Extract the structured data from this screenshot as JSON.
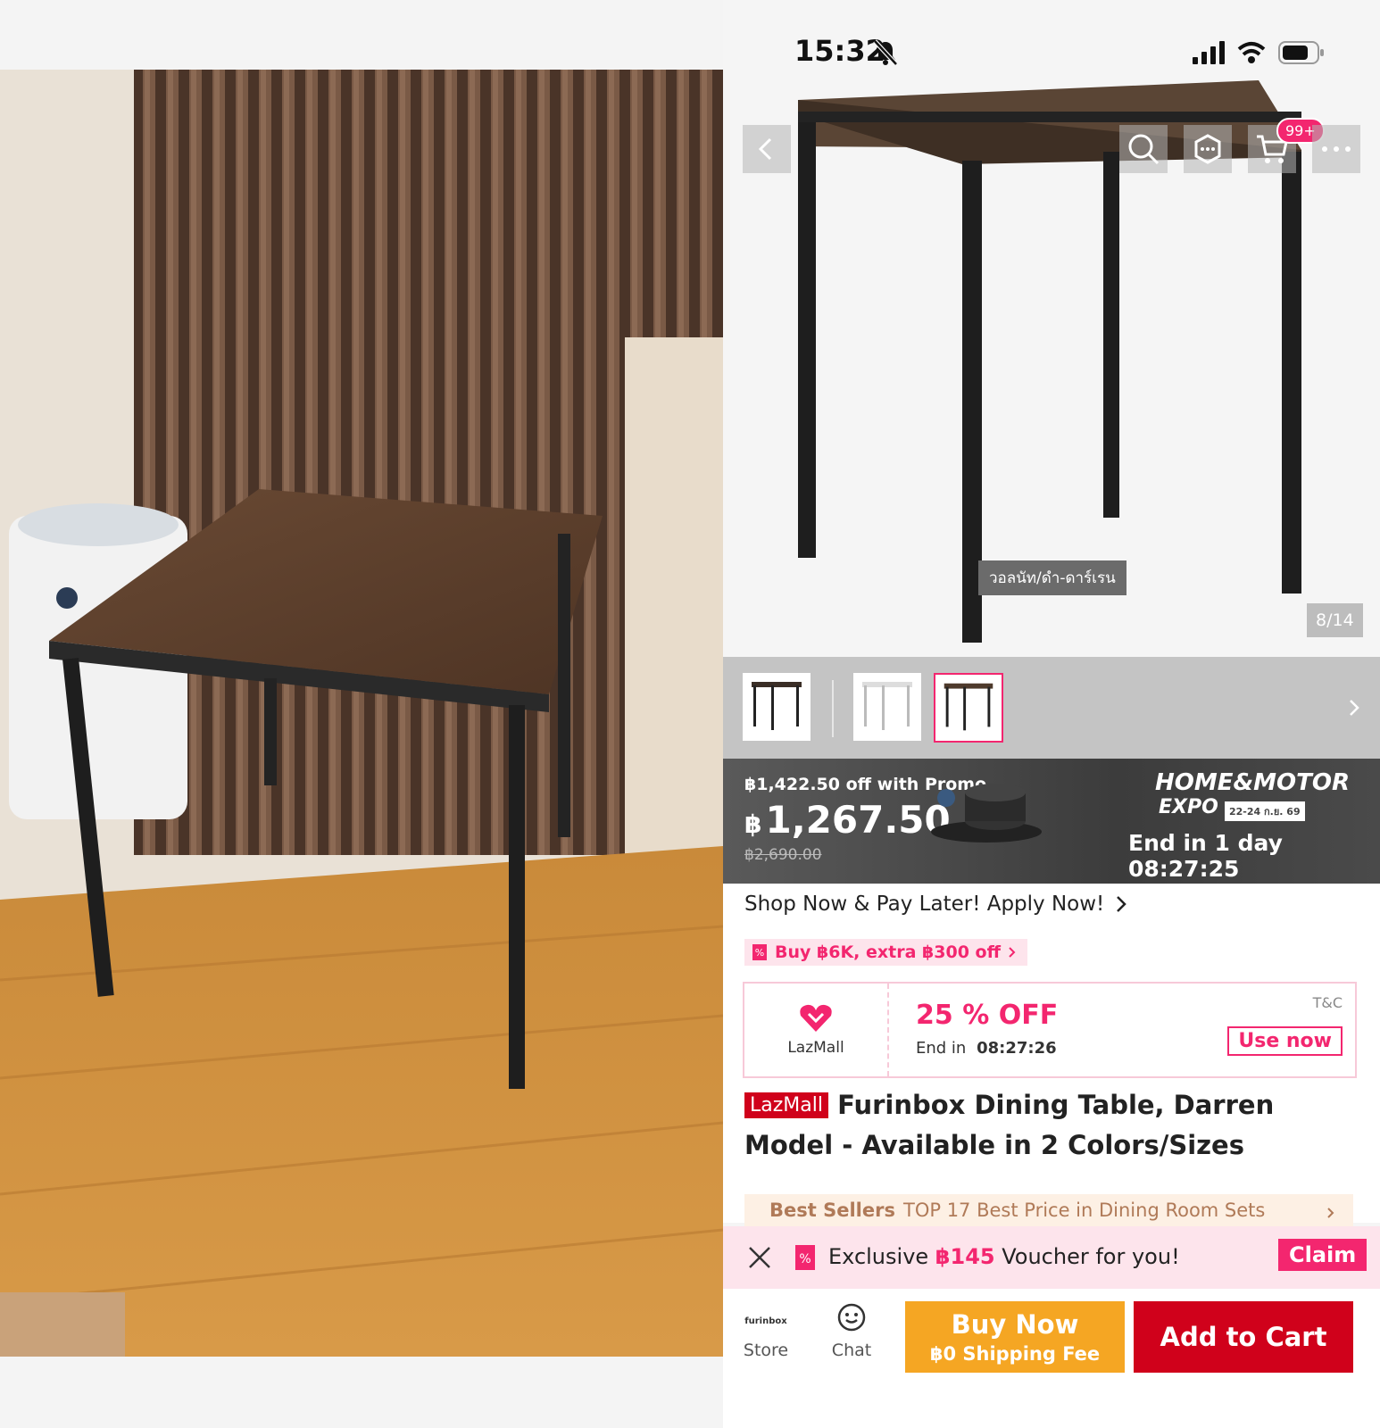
{
  "status_bar": {
    "time": "15:32"
  },
  "gallery": {
    "variant_tag": "วอลนัท/ดำ-ดาร์เรน",
    "counter": "8/14",
    "cart_badge": "99+"
  },
  "price": {
    "promo_line": "฿1,422.50 off with Promo",
    "currency": "฿",
    "current": "1,267.50",
    "original": "฿2,690.00",
    "campaign_line1": "HOME&MOTOR",
    "campaign_line2": "EXPO",
    "campaign_dates": "22-24 ก.ย. 69",
    "countdown": "End in 1 day 08:27:25"
  },
  "paylater": {
    "label": "Shop Now & Pay Later! Apply Now!"
  },
  "extra_offer": {
    "label": "Buy ฿6K, extra ฿300 off"
  },
  "coupon": {
    "brand": "LazMall",
    "discount": "25 % OFF",
    "end_label": "End in",
    "end_time": "08:27:26",
    "tnc": "T&C",
    "use_label": "Use now"
  },
  "product": {
    "badge": "LazMall",
    "title": "Furinbox Dining Table, Darren Model - Available in 2 Colors/Sizes"
  },
  "bestsellers": {
    "label": "Best Sellers",
    "text": "TOP 17 Best Price in Dining Room Sets"
  },
  "voucher": {
    "prefix": "Exclusive ",
    "amount": "฿145",
    "suffix": " Voucher for you!",
    "claim": "Claim"
  },
  "bottom": {
    "store_logo": "furinbox",
    "store_label": "Store",
    "chat_label": "Chat",
    "buy_now": "Buy Now",
    "buy_now_sub": "฿0 Shipping Fee",
    "add_to_cart": "Add to Cart"
  },
  "colors": {
    "accent": "#f3266f",
    "red": "#d0011b",
    "buy_now": "#f5a623",
    "lazmall": "#d0011b"
  }
}
